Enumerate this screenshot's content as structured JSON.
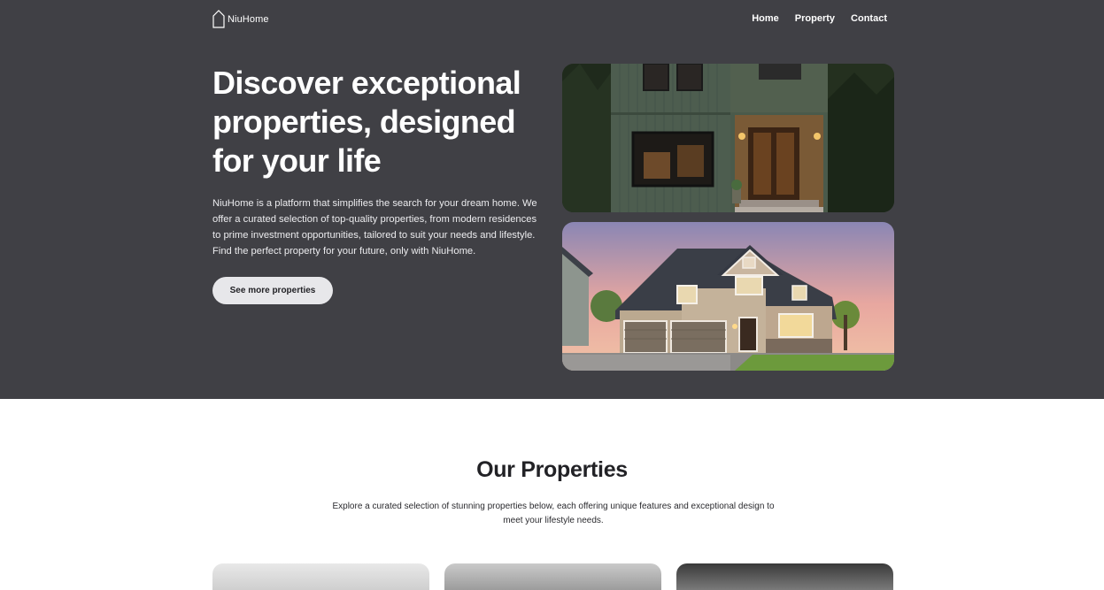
{
  "nav": {
    "logo_text": "NiuHome",
    "links": [
      "Home",
      "Property",
      "Contact"
    ]
  },
  "hero": {
    "title": "Discover exceptional properties, designed for your life",
    "description": "NiuHome is a platform that simplifies the search for your dream home. We offer a curated selection of top-quality properties, from modern residences to prime investment opportunities, tailored to suit your needs and lifestyle. Find the perfect property for your future, only with NiuHome.",
    "button_label": "See more properties"
  },
  "properties": {
    "title": "Our Properties",
    "description": "Explore a curated selection of stunning properties below, each offering unique features and exceptional design to meet your lifestyle needs."
  },
  "colors": {
    "hero_bg": "#404045",
    "button_bg": "#e7e7ea",
    "text_dark": "#222226"
  },
  "icons": [
    "house-logo-icon"
  ]
}
